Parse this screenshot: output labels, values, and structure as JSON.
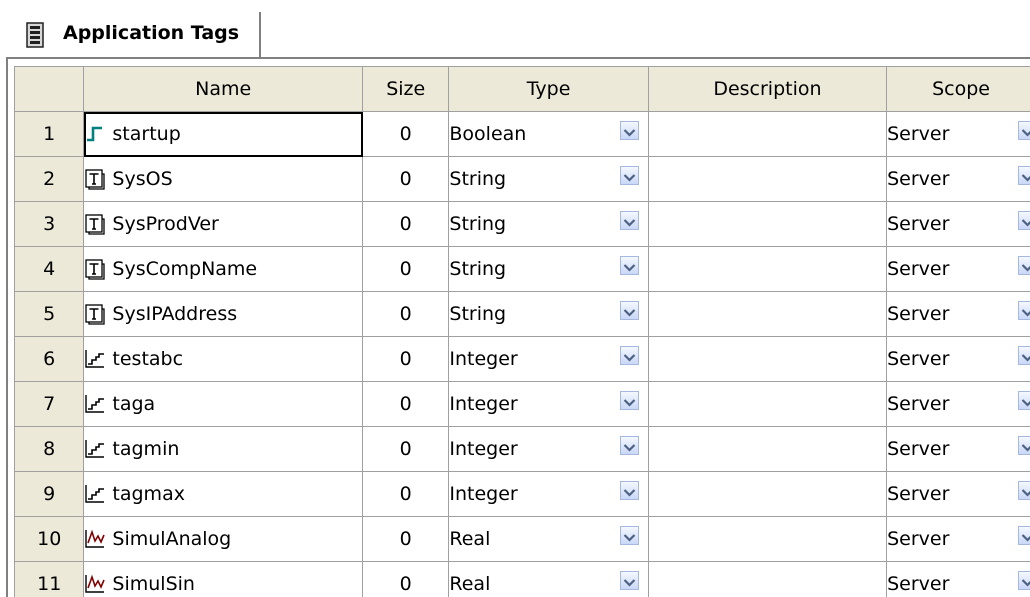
{
  "tab": {
    "label": "Application Tags",
    "icon": "tag-database-icon"
  },
  "columns": {
    "name": "Name",
    "size": "Size",
    "type": "Type",
    "description": "Description",
    "scope": "Scope"
  },
  "rows": [
    {
      "num": "1",
      "icon": "boolean-tag-icon",
      "name": "startup",
      "size": "0",
      "type": "Boolean",
      "description": "",
      "scope": "Server"
    },
    {
      "num": "2",
      "icon": "string-tag-icon",
      "name": "SysOS",
      "size": "0",
      "type": "String",
      "description": "",
      "scope": "Server"
    },
    {
      "num": "3",
      "icon": "string-tag-icon",
      "name": "SysProdVer",
      "size": "0",
      "type": "String",
      "description": "",
      "scope": "Server"
    },
    {
      "num": "4",
      "icon": "string-tag-icon",
      "name": "SysCompName",
      "size": "0",
      "type": "String",
      "description": "",
      "scope": "Server"
    },
    {
      "num": "5",
      "icon": "string-tag-icon",
      "name": "SysIPAddress",
      "size": "0",
      "type": "String",
      "description": "",
      "scope": "Server"
    },
    {
      "num": "6",
      "icon": "integer-tag-icon",
      "name": "testabc",
      "size": "0",
      "type": "Integer",
      "description": "",
      "scope": "Server"
    },
    {
      "num": "7",
      "icon": "integer-tag-icon",
      "name": "taga",
      "size": "0",
      "type": "Integer",
      "description": "",
      "scope": "Server"
    },
    {
      "num": "8",
      "icon": "integer-tag-icon",
      "name": "tagmin",
      "size": "0",
      "type": "Integer",
      "description": "",
      "scope": "Server"
    },
    {
      "num": "9",
      "icon": "integer-tag-icon",
      "name": "tagmax",
      "size": "0",
      "type": "Integer",
      "description": "",
      "scope": "Server"
    },
    {
      "num": "10",
      "icon": "real-tag-icon",
      "name": "SimulAnalog",
      "size": "0",
      "type": "Real",
      "description": "",
      "scope": "Server"
    },
    {
      "num": "11",
      "icon": "real-tag-icon",
      "name": "SimulSin",
      "size": "0",
      "type": "Real",
      "description": "",
      "scope": "Server"
    }
  ],
  "selected_row": "1",
  "colors": {
    "header_bg": "#ece9d8",
    "grid_line": "#a0a0a0",
    "dropdown_arrow": "#4d6185",
    "boolean_icon": "#008080",
    "real_icon": "#800000"
  }
}
